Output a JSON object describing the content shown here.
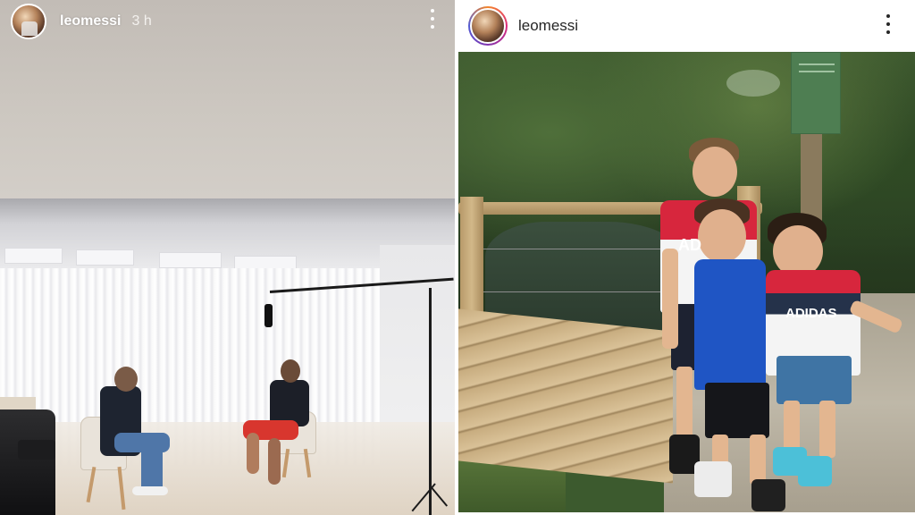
{
  "story": {
    "username": "leomessi",
    "time": "3 h"
  },
  "post": {
    "username": "leomessi"
  },
  "shirts": {
    "middle_kid_print": "AD",
    "right_kid_print": "ADIDAS"
  },
  "colors": {
    "story_background": "#ccc7c1",
    "post_background": "#ffffff",
    "username_dark": "#262626",
    "story_ring_gradient": [
      "#f58529",
      "#dd2a7b",
      "#8134af",
      "#515bd4"
    ]
  },
  "icons": {
    "story_menu": "more-vertical-icon",
    "post_menu": "more-vertical-icon"
  }
}
